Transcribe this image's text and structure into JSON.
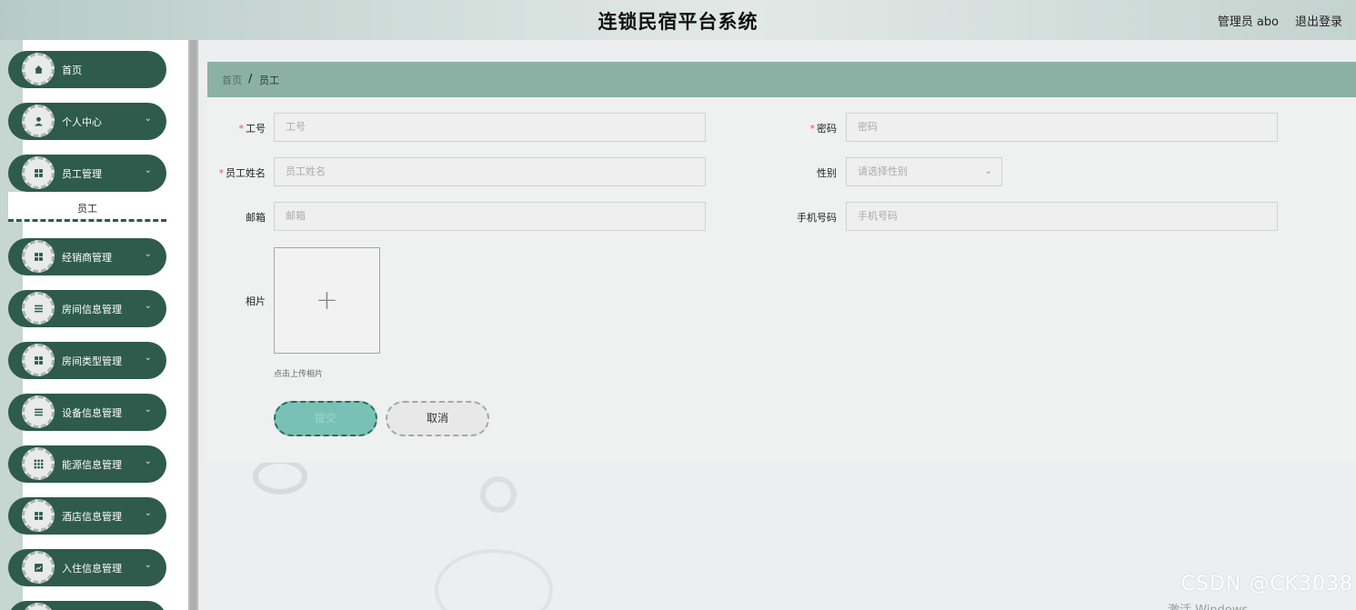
{
  "header": {
    "title": "连锁民宿平台系统",
    "user": "管理员 abo",
    "logout": "退出登录"
  },
  "sidebar": {
    "items": [
      {
        "label": "首页",
        "icon": "home-icon",
        "has_arrow": false
      },
      {
        "label": "个人中心",
        "icon": "user-icon",
        "has_arrow": true
      },
      {
        "label": "员工管理",
        "icon": "grid-icon",
        "has_arrow": true
      },
      {
        "label": "经销商管理",
        "icon": "grid-icon",
        "has_arrow": true
      },
      {
        "label": "房间信息管理",
        "icon": "list-icon",
        "has_arrow": true
      },
      {
        "label": "房间类型管理",
        "icon": "grid-icon",
        "has_arrow": true
      },
      {
        "label": "设备信息管理",
        "icon": "list-icon",
        "has_arrow": true
      },
      {
        "label": "能源信息管理",
        "icon": "apps-icon",
        "has_arrow": true
      },
      {
        "label": "酒店信息管理",
        "icon": "grid-icon",
        "has_arrow": true
      },
      {
        "label": "入住信息管理",
        "icon": "chart-icon",
        "has_arrow": true
      }
    ],
    "submenu_item": "员工"
  },
  "breadcrumb": {
    "home": "首页",
    "separator": "/",
    "current": "员工"
  },
  "form": {
    "employee_no": {
      "label": "工号",
      "placeholder": "工号",
      "required": true
    },
    "password": {
      "label": "密码",
      "placeholder": "密码",
      "required": true
    },
    "employee_name": {
      "label": "员工姓名",
      "placeholder": "员工姓名",
      "required": true
    },
    "gender": {
      "label": "性别",
      "placeholder": "请选择性别"
    },
    "email": {
      "label": "邮箱",
      "placeholder": "邮箱"
    },
    "phone": {
      "label": "手机号码",
      "placeholder": "手机号码"
    },
    "photo": {
      "label": "相片",
      "hint": "点击上传相片",
      "plus": "+"
    },
    "submit_label": "提交",
    "cancel_label": "取消",
    "required_mark": "*"
  },
  "overlay": {
    "watermark": "CSDN @CK3038",
    "activate": "激活 Windows"
  },
  "colors": {
    "sidebar_item": "#2e5b4b",
    "breadcrumb_bg": "#8bb1a5",
    "submit_bg": "#78c1b6",
    "required": "#e05555"
  }
}
